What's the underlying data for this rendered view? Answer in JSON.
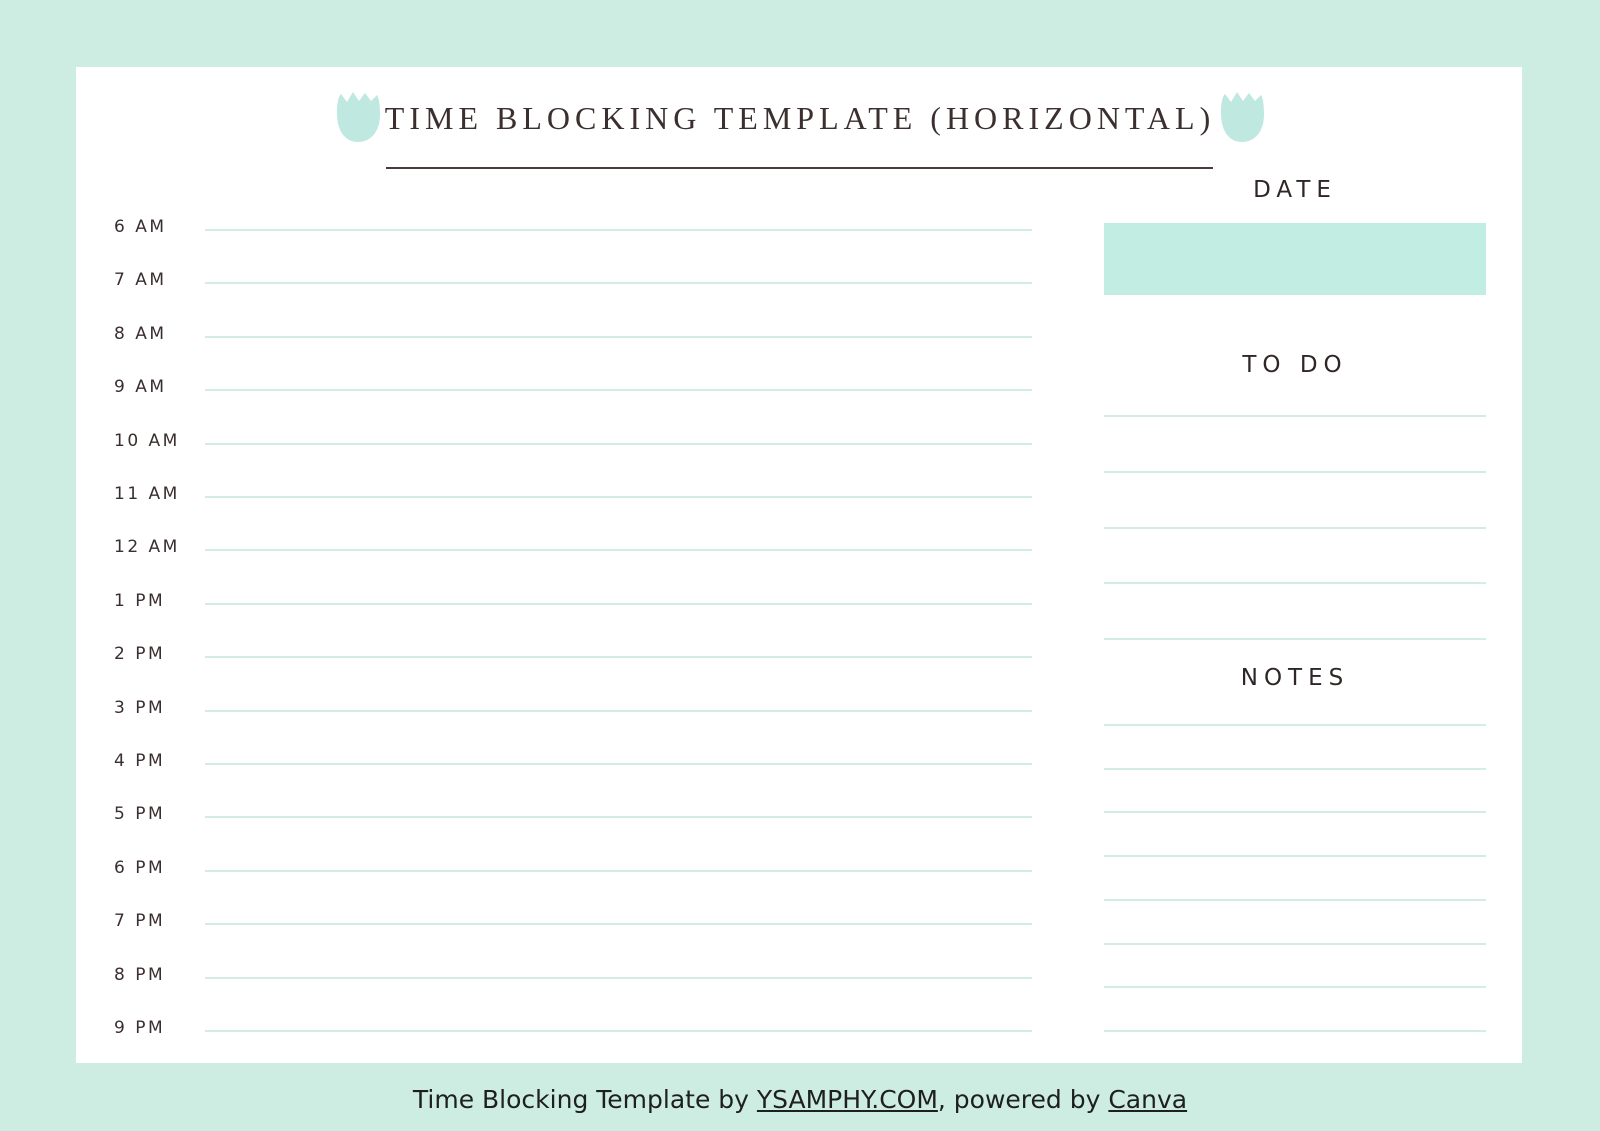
{
  "document": {
    "title": "TIME BLOCKING TEMPLATE (HORIZONTAL)",
    "colors": {
      "background": "#cdede3",
      "accent": "#c2ede3",
      "line": "#d3ece6",
      "text": "#3a2e2e"
    },
    "icons": {
      "decoration": "tulip-icon"
    }
  },
  "schedule": {
    "times": [
      "6 AM",
      "7 AM",
      "8 AM",
      "9 AM",
      "10 AM",
      "11 AM",
      "12 AM",
      "1 PM",
      "2 PM",
      "3 PM",
      "4 PM",
      "5 PM",
      "6 PM",
      "7 PM",
      "8 PM",
      "9 PM"
    ]
  },
  "sidebar": {
    "date_label": "DATE",
    "date_value": "",
    "todo_label": "TO DO",
    "todo_line_count": 5,
    "notes_label": "NOTES",
    "notes_line_count": 8
  },
  "footer": {
    "prefix": "Time Blocking Template by ",
    "site_link": "YSAMPHY.COM",
    "middle": ", powered by ",
    "canva_link": "Canva"
  }
}
